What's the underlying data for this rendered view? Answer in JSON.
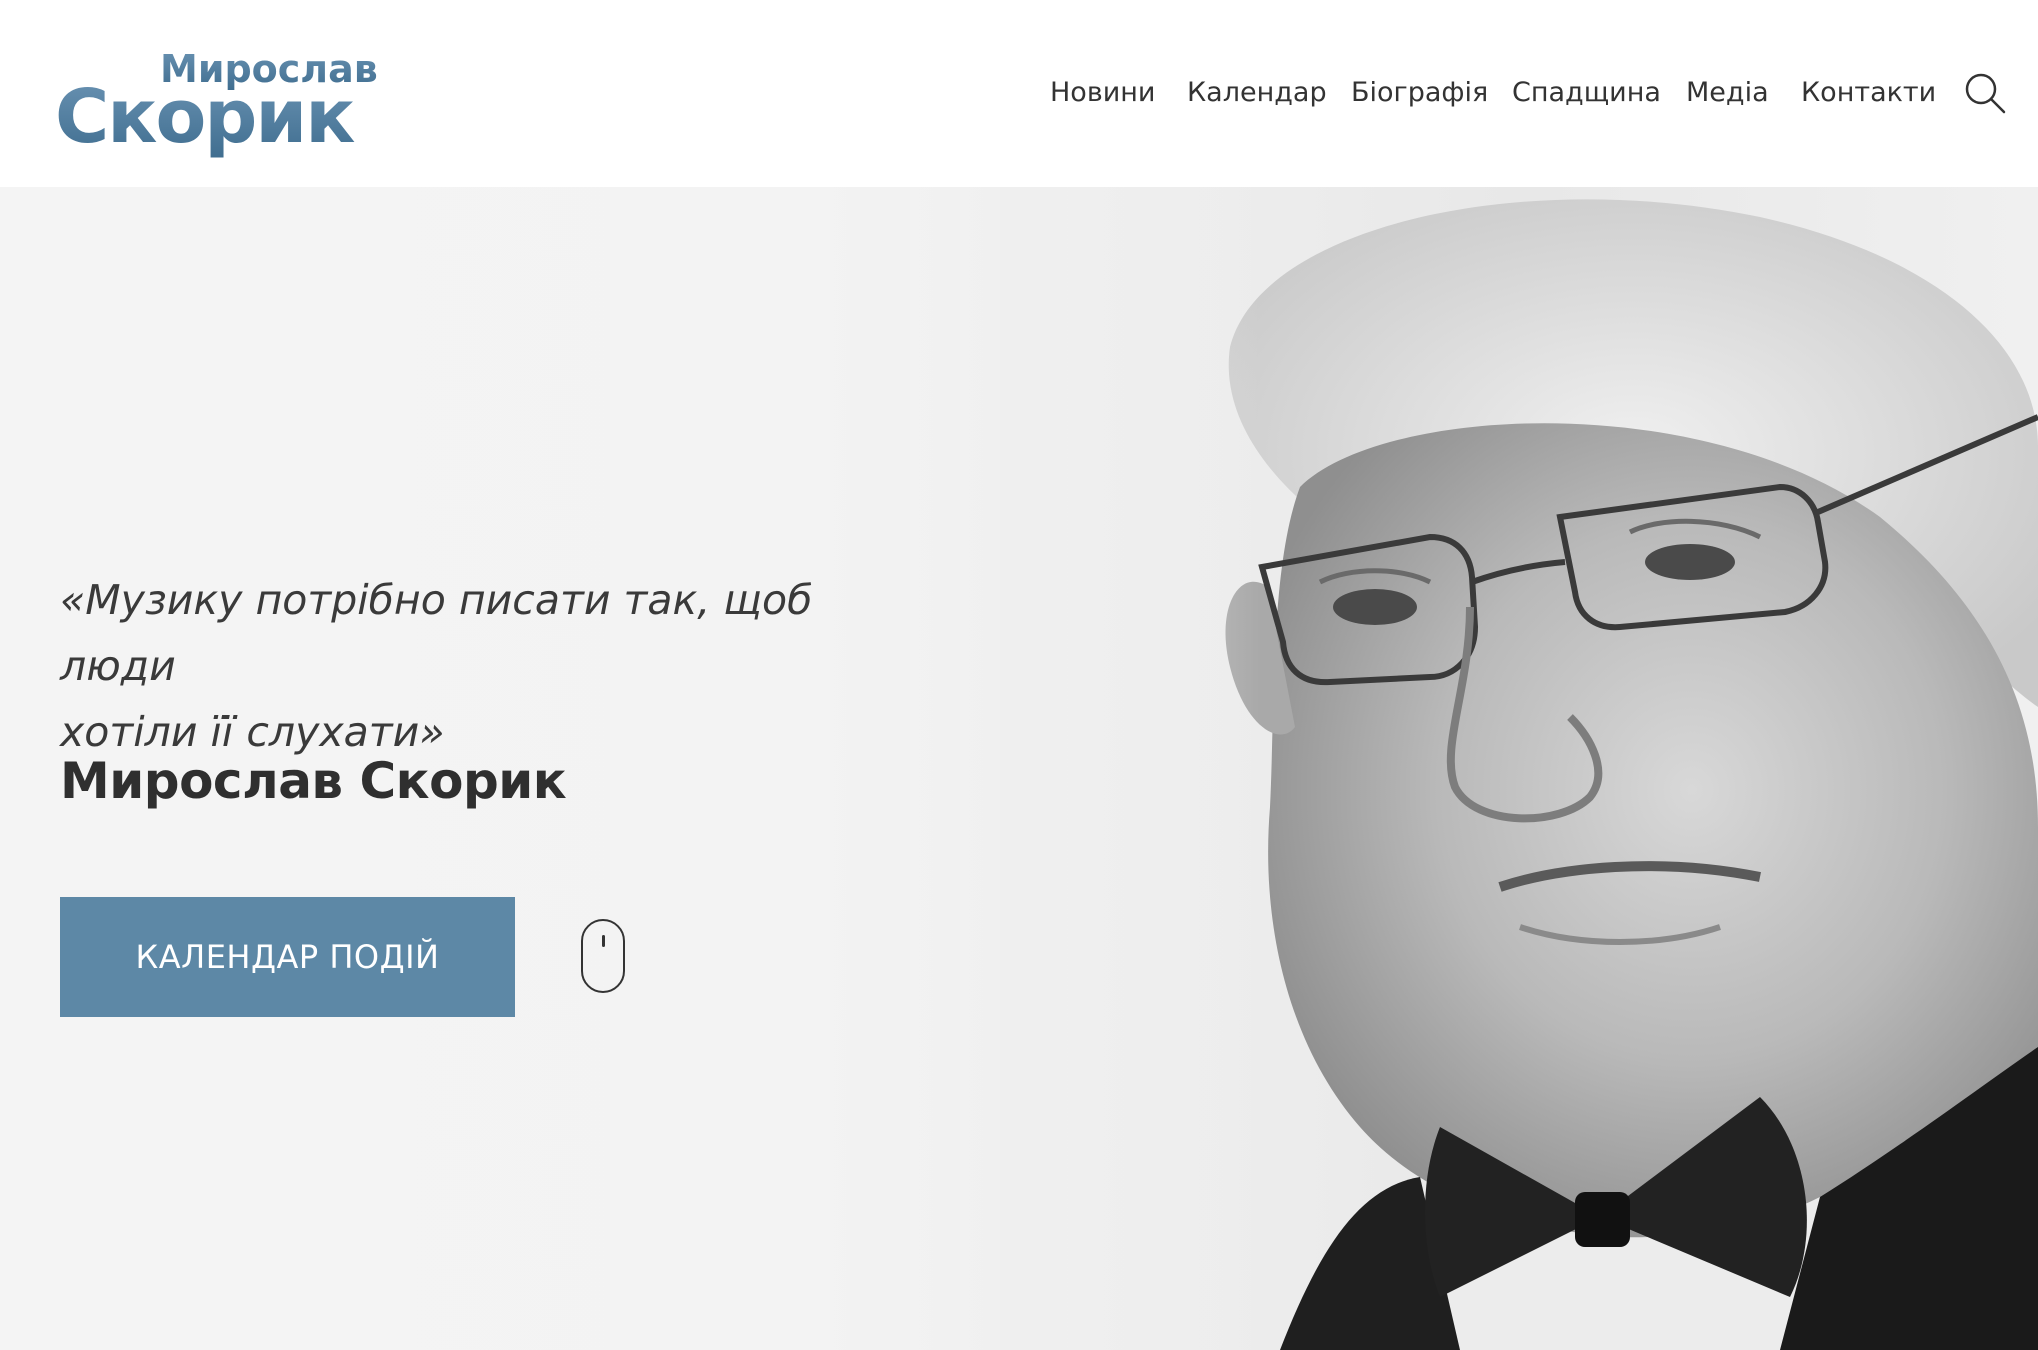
{
  "header": {
    "logo": {
      "line1": "Мирослав",
      "line2": "Скорик"
    },
    "nav": [
      "Новини",
      "Календар",
      "Біографія",
      "Спадщина",
      "Медіа",
      "Контакти"
    ],
    "search_icon": "search-icon"
  },
  "hero": {
    "quote_line1": "«Музику потрібно писати так, щоб люди",
    "quote_line2": "хотіли її слухати»",
    "author": "Мирослав Скорик",
    "cta_label": "КАЛЕНДАР ПОДІЙ",
    "scroll_icon": "mouse-scroll-icon"
  },
  "colors": {
    "accent": "#5d88a6",
    "text": "#333333",
    "logo_top": "#5d88a6",
    "logo_bottom": "#3e6b8c"
  }
}
